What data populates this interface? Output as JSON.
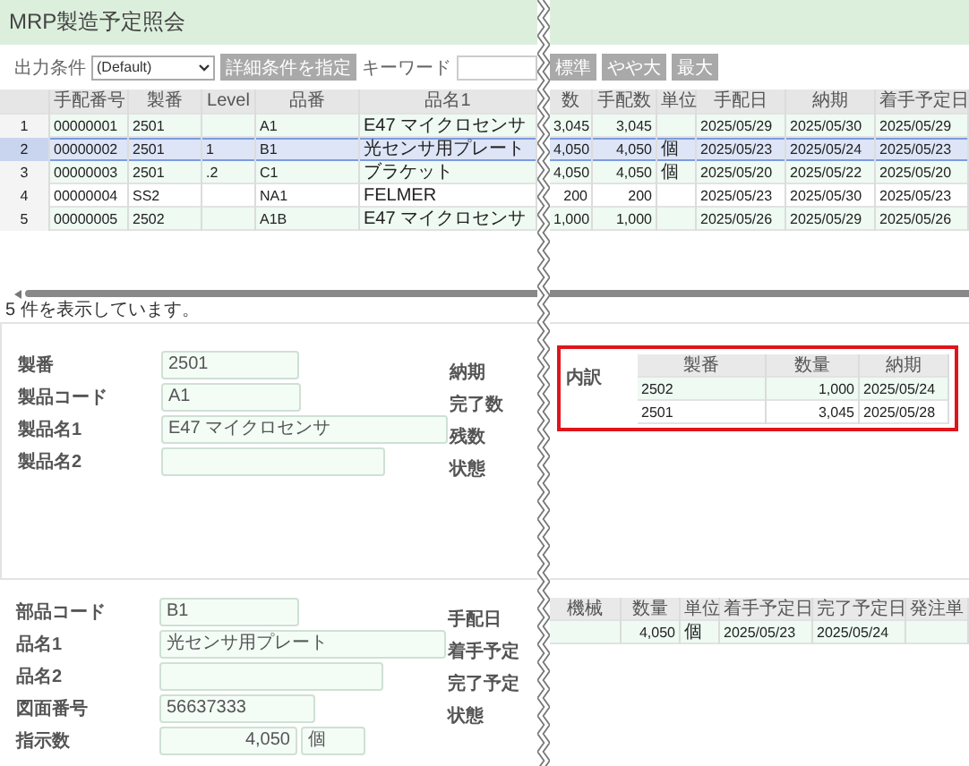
{
  "title": "MRP製造予定照会",
  "toolbar": {
    "condition_label": "出力条件",
    "condition_value": "(Default)",
    "detail_button": "詳細条件を指定",
    "keyword_label": "キーワード",
    "size_buttons": [
      "標準",
      "やや大",
      "最大"
    ]
  },
  "grid": {
    "columns": [
      "手配番号",
      "製番",
      "Level",
      "品番",
      "品名1",
      "数",
      "手配数",
      "単位",
      "手配日",
      "納期",
      "着手予定日"
    ],
    "rows": [
      {
        "row_number": "1",
        "selected": false,
        "cells": [
          "00000001",
          "2501",
          null,
          "A1",
          "E47 マイクロセンサ",
          "3,045",
          "3,045",
          null,
          "2025/05/29",
          "2025/05/30",
          "2025/05/29"
        ]
      },
      {
        "row_number": "2",
        "selected": true,
        "cells": [
          "00000002",
          "2501",
          "1",
          "B1",
          "光センサ用プレート",
          "4,050",
          "4,050",
          "個",
          "2025/05/23",
          "2025/05/24",
          "2025/05/23"
        ]
      },
      {
        "row_number": "3",
        "selected": false,
        "cells": [
          "00000003",
          "2501",
          ".2",
          "C1",
          "ブラケット",
          "4,050",
          "4,050",
          "個",
          "2025/05/20",
          "2025/05/22",
          "2025/05/20"
        ]
      },
      {
        "row_number": "4",
        "selected": false,
        "cells": [
          "00000004",
          "SS2",
          null,
          "NA1",
          "FELMER",
          "200",
          "200",
          null,
          "2025/05/23",
          "2025/05/30",
          "2025/05/23"
        ]
      },
      {
        "row_number": "5",
        "selected": false,
        "cells": [
          "00000005",
          "2502",
          null,
          "A1B",
          "E47 マイクロセンサ",
          "1,000",
          "1,000",
          null,
          "2025/05/26",
          "2025/05/29",
          "2025/05/26"
        ]
      }
    ]
  },
  "record_count": "5 件を表示しています。",
  "product_panel": {
    "fields": [
      {
        "label": "製番",
        "value": "2501"
      },
      {
        "label": "製品コード",
        "value": "A1"
      },
      {
        "label": "製品名1",
        "value": "E47 マイクロセンサ"
      },
      {
        "label": "製品名2"
      }
    ],
    "side_labels": [
      "納期",
      "完了数",
      "残数",
      "状態"
    ],
    "breakdown": {
      "label": "内訳",
      "columns": [
        "製番",
        "数量",
        "納期"
      ],
      "rows": [
        [
          "2502",
          "1,000",
          "2025/05/24"
        ],
        [
          "2501",
          "3,045",
          "2025/05/28"
        ]
      ]
    }
  },
  "part_panel": {
    "fields": [
      {
        "label": "部品コード",
        "value": "B1"
      },
      {
        "label": "品名1",
        "value": "光センサ用プレート"
      },
      {
        "label": "品名2"
      },
      {
        "label": "図面番号",
        "value": "56637333"
      },
      {
        "label": "指示数",
        "value": "4,050",
        "unit": "個"
      }
    ],
    "side_labels": [
      "手配日",
      "着手予定",
      "完了予定",
      "状態"
    ],
    "process_table": {
      "columns": [
        "機械",
        "数量",
        "単位",
        "着手予定日",
        "完了予定日",
        "発注単"
      ],
      "rows": [
        [
          null,
          "4,050",
          "個",
          "2025/05/23",
          "2025/05/24",
          null
        ]
      ]
    }
  }
}
